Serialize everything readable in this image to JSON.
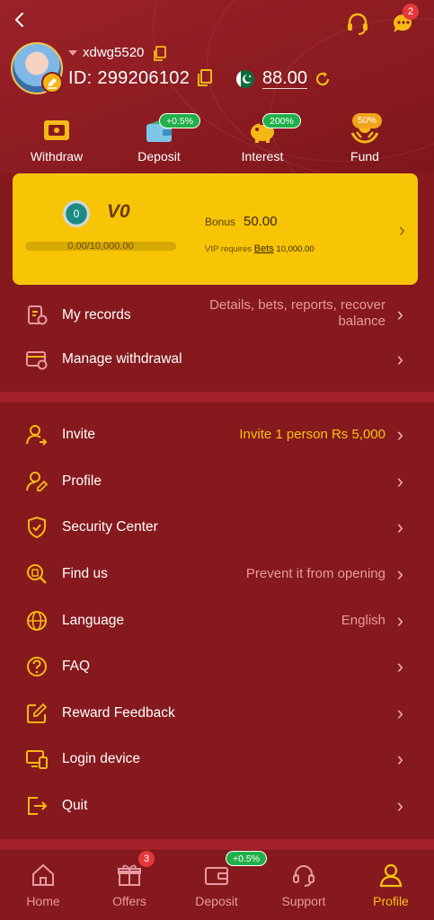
{
  "colors": {
    "background": "#86191d",
    "accent_yellow": "#f5c211",
    "muted_pink": "#e79aa1",
    "vip_card": "#f7c506",
    "badge_green": "#22b04a",
    "badge_red": "#e5383b"
  },
  "header": {
    "back_icon": "chevron-left-icon",
    "support_icon": "headset-icon",
    "chat_icon": "chat-bubble-icon",
    "chat_badge": "2",
    "username": "xdwg5520",
    "user_id": "ID: 299206102",
    "balance": "88.00",
    "currency_flag": "pakistan-flag-icon"
  },
  "quick_actions": [
    {
      "label": "Withdraw",
      "icon": "ticket-icon",
      "badge": ""
    },
    {
      "label": "Deposit",
      "icon": "wallet-icon",
      "badge": "+0.5%"
    },
    {
      "label": "Interest",
      "icon": "piggy-bank-icon",
      "badge": "200%"
    },
    {
      "label": "Fund",
      "icon": "hands-coin-icon",
      "badge": "50%"
    }
  ],
  "vip": {
    "level_badge": "0",
    "level": "V0",
    "progress_text": "0.00/10,000.00",
    "progress_fraction": 0,
    "bonus_label": "Bonus",
    "bonus_value": "50.00",
    "requires_text": "VIP requires",
    "bets_link": "Bets",
    "requires_amount": "10,000.00"
  },
  "section1": [
    {
      "label": "My records",
      "value_line1": "Details, bets, reports, recover",
      "value_line2": "balance",
      "icon": "records-icon"
    },
    {
      "label": "Manage withdrawal",
      "value": "",
      "icon": "card-settings-icon"
    }
  ],
  "section2": [
    {
      "label": "Invite",
      "value": "Invite 1 person Rs 5,000",
      "icon": "invite-user-icon"
    },
    {
      "label": "Profile",
      "value": "",
      "icon": "user-edit-icon"
    },
    {
      "label": "Security Center",
      "value": "",
      "icon": "shield-check-icon"
    },
    {
      "label": "Find us",
      "value": "Prevent it from opening",
      "icon": "search-building-icon"
    },
    {
      "label": "Language",
      "value": "English",
      "icon": "globe-icon"
    },
    {
      "label": "FAQ",
      "value": "",
      "icon": "question-circle-icon"
    },
    {
      "label": "Reward Feedback",
      "value": "",
      "icon": "edit-square-icon"
    },
    {
      "label": "Login device",
      "value": "",
      "icon": "devices-icon"
    },
    {
      "label": "Quit",
      "value": "",
      "icon": "logout-icon"
    }
  ],
  "tabbar": [
    {
      "label": "Home",
      "icon": "home-icon",
      "badge": ""
    },
    {
      "label": "Offers",
      "icon": "gift-icon",
      "badge": "3"
    },
    {
      "label": "Deposit",
      "icon": "wallet-icon",
      "badge": "+0.5%"
    },
    {
      "label": "Support",
      "icon": "headset-icon",
      "badge": ""
    },
    {
      "label": "Profile",
      "icon": "user-icon",
      "badge": "",
      "active": true
    }
  ]
}
